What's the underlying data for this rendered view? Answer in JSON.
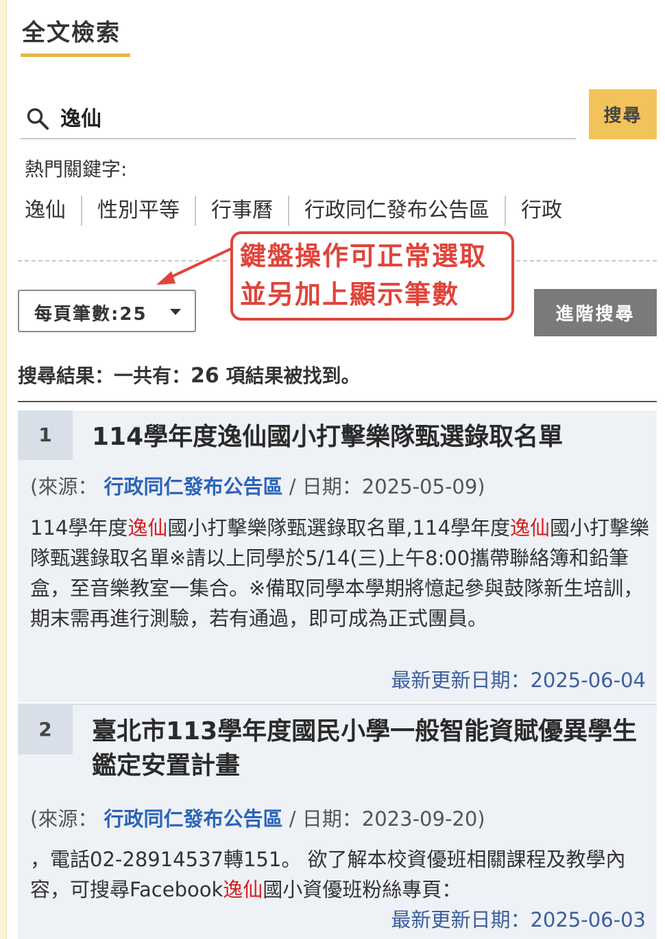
{
  "page": {
    "title": "全文檢索"
  },
  "search": {
    "query": "逸仙",
    "button_label": "搜尋"
  },
  "hot_keywords": {
    "label": "熱門關鍵字:",
    "items": [
      "逸仙",
      "性別平等",
      "行事曆",
      "行政同仁發布公告區",
      "行政"
    ]
  },
  "per_page": {
    "label": "每頁筆數:25"
  },
  "annotation": {
    "line1": "鍵盤操作可正常選取",
    "line2": "並另加上顯示筆數",
    "color": "#e0443a"
  },
  "advanced_search": {
    "label": "進階搜尋"
  },
  "summary": {
    "prefix": "搜尋結果：一共有：",
    "count": "26",
    "suffix": " 項結果被找到。"
  },
  "results": [
    {
      "number": "1",
      "title": "114學年度逸仙國小打擊樂隊甄選錄取名單",
      "source_prefix": "(來源：",
      "source": "行政同仁發布公告區",
      "date_text": " / 日期：2025-05-09)",
      "snippet": [
        {
          "t": "114學年度"
        },
        {
          "t": "逸仙",
          "hl": true
        },
        {
          "t": "國小打擊樂隊甄選錄取名單,114學年度"
        },
        {
          "t": "逸仙",
          "hl": true
        },
        {
          "t": "國小打擊樂隊甄選錄取名單※請以上同學於5/14(三)上午8:00攜帶聯絡簿和鉛筆盒，至音樂教室一集合。※備取同學本學期將憶起參與鼓隊新生培訓，期末需再進行測驗，若有通過，即可成為正式團員。"
        }
      ],
      "updated": "最新更新日期：2025-06-04"
    },
    {
      "number": "2",
      "title": "臺北市113學年度國民小學一般智能資賦優異學生鑑定安置計畫",
      "source_prefix": "(來源：",
      "source": "行政同仁發布公告區",
      "date_text": " / 日期：2023-09-20)",
      "snippet": [
        {
          "t": "，電話02-28914537轉151。 欲了解本校資優班相關課程及教學內容，可搜尋Facebook"
        },
        {
          "t": "逸仙",
          "hl": true
        },
        {
          "t": "國小資優班粉絲專頁："
        }
      ],
      "updated": "最新更新日期：2025-06-03"
    }
  ],
  "colors": {
    "accent": "#f2c35a",
    "highlight": "#d42020",
    "link": "#2b63b8"
  }
}
